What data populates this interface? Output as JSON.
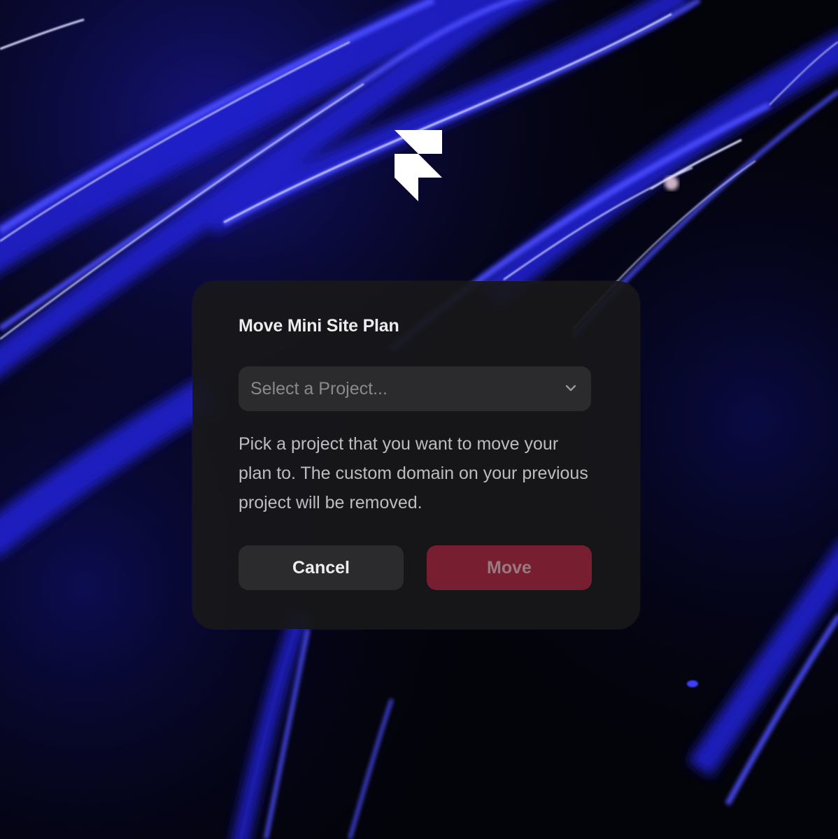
{
  "dialog": {
    "title": "Move Mini Site Plan",
    "select_placeholder": "Select a Project...",
    "description": "Pick a project that you want to move your plan to. The custom domain on your previous project will be removed.",
    "cancel_label": "Cancel",
    "move_label": "Move"
  },
  "icons": {
    "logo": "framer-logo",
    "select_chevron": "chevron-down-icon"
  },
  "colors": {
    "background": "#03030a",
    "light_streaks": "#2a2cff",
    "dialog_bg": "#18181a",
    "field_bg": "#2b2b2e",
    "move_button_bg": "#771f31"
  }
}
